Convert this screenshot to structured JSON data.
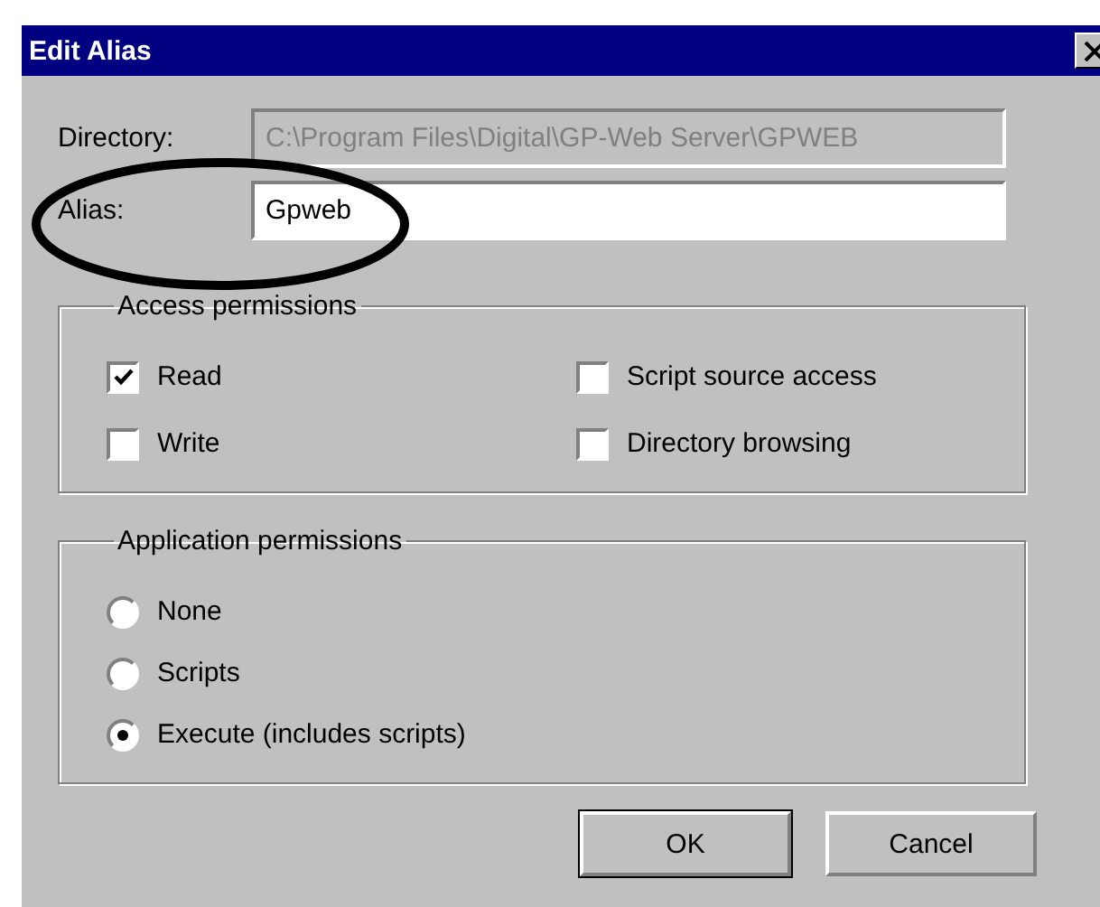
{
  "window": {
    "title": "Edit Alias"
  },
  "directory": {
    "label": "Directory:",
    "value": "C:\\Program Files\\Digital\\GP-Web Server\\GPWEB",
    "disabled": true
  },
  "alias": {
    "label": "Alias:",
    "value": "Gpweb",
    "disabled": false
  },
  "access_permissions": {
    "title": "Access permissions",
    "options": [
      {
        "label": "Read",
        "checked": true
      },
      {
        "label": "Script source access",
        "checked": false
      },
      {
        "label": "Write",
        "checked": false
      },
      {
        "label": "Directory browsing",
        "checked": false
      }
    ]
  },
  "application_permissions": {
    "title": "Application permissions",
    "options": [
      {
        "label": "None",
        "selected": false
      },
      {
        "label": "Scripts",
        "selected": false
      },
      {
        "label": "Execute (includes scripts)",
        "selected": true
      }
    ]
  },
  "buttons": [
    {
      "label": "OK",
      "default": true
    },
    {
      "label": "Cancel",
      "default": false
    }
  ]
}
